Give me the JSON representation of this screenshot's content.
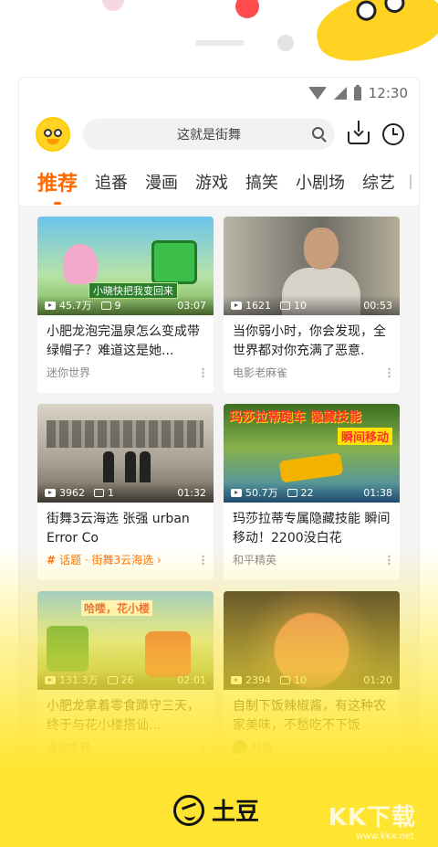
{
  "statusbar": {
    "time": "12:30"
  },
  "search": {
    "placeholder": "这就是街舞"
  },
  "tabs": [
    "推荐",
    "追番",
    "漫画",
    "游戏",
    "搞笑",
    "小剧场",
    "综艺"
  ],
  "cards": [
    {
      "views": "45.7万",
      "comments": "9",
      "duration": "03:07",
      "title": "小肥龙泡完温泉怎么变成带绿帽子？难道这是她...",
      "channel": "迷你世界",
      "thumb_caption": "小晓快把我变回来"
    },
    {
      "views": "1621",
      "comments": "10",
      "duration": "00:53",
      "title": "当你弱小时，你会发现，全世界都对你充满了恶意.",
      "channel": "电影老麻雀"
    },
    {
      "views": "3962",
      "comments": "1",
      "duration": "01:32",
      "title": "街舞3云海选 张强 urban Error Co",
      "topic": "话题 · 街舞3云海选 ›"
    },
    {
      "views": "50.7万",
      "comments": "22",
      "duration": "01:38",
      "title": "玛莎拉蒂专属隐藏技能 瞬间移动！2200没白花",
      "channel": "和平精英",
      "thumb_caption": "玛莎拉蒂跑车 隐藏技能",
      "thumb_caption2": "瞬间移动"
    },
    {
      "views": "131.3万",
      "comments": "26",
      "duration": "02:01",
      "title": "小肥龙拿着零食蹲守三天，终于与花小楼搭讪...",
      "channel": "迷你世界",
      "thumb_caption": "哈喽，花小楼"
    },
    {
      "views": "2394",
      "comments": "10",
      "duration": "01:20",
      "title": "自制下饭辣椒酱，有这种农家美味，不愁吃不下饭",
      "channel": "村意"
    }
  ],
  "brand": {
    "name": "土豆"
  },
  "watermark": {
    "text": "KK下载",
    "url": "www.kkx.net"
  },
  "colors": {
    "accent": "#ff6a00",
    "brand_yellow": "#ffe531"
  }
}
